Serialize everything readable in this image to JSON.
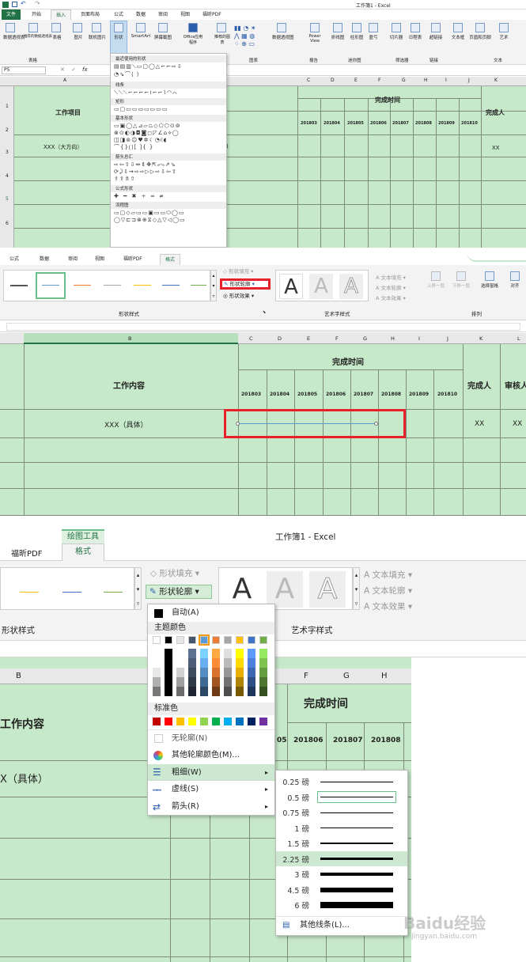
{
  "p1": {
    "title": "工作簿1 - Excel",
    "tabs": [
      "文件",
      "开始",
      "插入",
      "页面布局",
      "公式",
      "数据",
      "审阅",
      "视图",
      "福昕PDF"
    ],
    "active_tab": "插入",
    "buttons": [
      "数据透视表",
      "推荐的数据透视表",
      "表格",
      "图片",
      "联机图片",
      "形状",
      "SmartArt",
      "屏幕截图",
      "Office应用程序",
      "推荐的图表",
      "数据透视图",
      "Power View",
      "折线图",
      "柱形图",
      "盈亏",
      "切片器",
      "日程表",
      "超链接",
      "文本框",
      "页眉和页脚",
      "艺术"
    ],
    "groups": [
      "表格",
      "图表",
      "报告",
      "迷你图",
      "筛选器",
      "链接",
      "文本"
    ],
    "namebox": "P5",
    "fx": "fx",
    "shape_sections": [
      "最近使用的形状",
      "线条",
      "矩形",
      "基本形状",
      "箭头总汇",
      "公式形状",
      "流程图"
    ],
    "header_work": "工作项目",
    "header_time": "完成时间",
    "header_person": "完成人",
    "months": [
      "201803",
      "201804",
      "201805",
      "201806",
      "201807",
      "201808",
      "201809",
      "201810"
    ],
    "row3_label": "XXX（大方向）",
    "row3_person": "XX",
    "cols": [
      "A",
      "C",
      "D",
      "E",
      "F",
      "G",
      "H",
      "I",
      "J",
      "K"
    ],
    "rows": [
      "1",
      "2",
      "3",
      "4",
      "5",
      "6"
    ]
  },
  "p2": {
    "tabs": [
      "公式",
      "数据",
      "审阅",
      "视图",
      "福昕PDF",
      "格式"
    ],
    "active_tab": "格式",
    "fill": "形状填充",
    "outline": "形状轮廓",
    "effect": "形状效果",
    "styles_label": "形状样式",
    "text_fill": "文本填充",
    "text_outline": "文本轮廓",
    "text_effect": "文本效果",
    "wordart_label": "艺术字样式",
    "arrange": [
      "上移一层",
      "下移一层",
      "选择窗格",
      "对齐"
    ],
    "arrange_label": "排列",
    "cols": [
      "B",
      "C",
      "D",
      "E",
      "F",
      "G",
      "H",
      "I",
      "J",
      "K",
      "L"
    ],
    "header_content": "工作内容",
    "header_time": "完成时间",
    "header_person": "完成人",
    "header_review": "审核人",
    "months": [
      "201803",
      "201804",
      "201805",
      "201806",
      "201807",
      "201808",
      "201809",
      "201810"
    ],
    "row_label": "XXX（具体）",
    "row_person": "XX",
    "row_review": "XX"
  },
  "p3": {
    "context_tab": "绘图工具",
    "title": "工作簿1 - Excel",
    "tabs": [
      "福昕PDF",
      "格式"
    ],
    "fill": "形状填充",
    "outline": "形状轮廓",
    "text_fill": "文本填充",
    "text_outline": "文本轮廓",
    "text_effect": "文本效果",
    "styles_label": "形状样式",
    "wordart_label": "艺术字样式",
    "cols": [
      "B",
      "F",
      "G",
      "H"
    ],
    "header_content": "工作内容",
    "header_time": "完成时间",
    "months": [
      "201806",
      "201807",
      "201808"
    ],
    "month_partial": "05",
    "row_label": "X（具体）",
    "menu": {
      "auto": "自动(A)",
      "theme_colors": "主题颜色",
      "standard_colors": "标准色",
      "no_outline": "无轮廓(N)",
      "more_colors": "其他轮廓颜色(M)...",
      "weight": "粗细(W)",
      "dashes": "虚线(S)",
      "arrows": "箭头(R)"
    },
    "weights": [
      "0.25 磅",
      "0.5 磅",
      "0.75 磅",
      "1 磅",
      "1.5 磅",
      "2.25 磅",
      "3 磅",
      "4.5 磅",
      "6 磅"
    ],
    "weight_values": [
      0.25,
      0.5,
      0.75,
      1,
      1.5,
      2.25,
      3,
      4.5,
      6
    ],
    "more_lines": "其他线条(L)...",
    "theme_row": [
      "#ffffff",
      "#000000",
      "#e7e6e6",
      "#44546a",
      "#5b9bd5",
      "#ed7d31",
      "#a5a5a5",
      "#ffc000",
      "#4472c4",
      "#70ad47"
    ],
    "standard_row": [
      "#c00000",
      "#ff0000",
      "#ffc000",
      "#ffff00",
      "#92d050",
      "#00b050",
      "#00b0f0",
      "#0070c0",
      "#002060",
      "#7030a0"
    ],
    "watermark": "Baidu经验",
    "watermark_url": "jingyan.baidu.com"
  },
  "colors": {
    "sheet_green": "#c6e9c9",
    "header_green": "#aadcb0",
    "ribbon": "#f3f3f3",
    "accent_red": "#e8202a",
    "excel_green": "#217346"
  }
}
